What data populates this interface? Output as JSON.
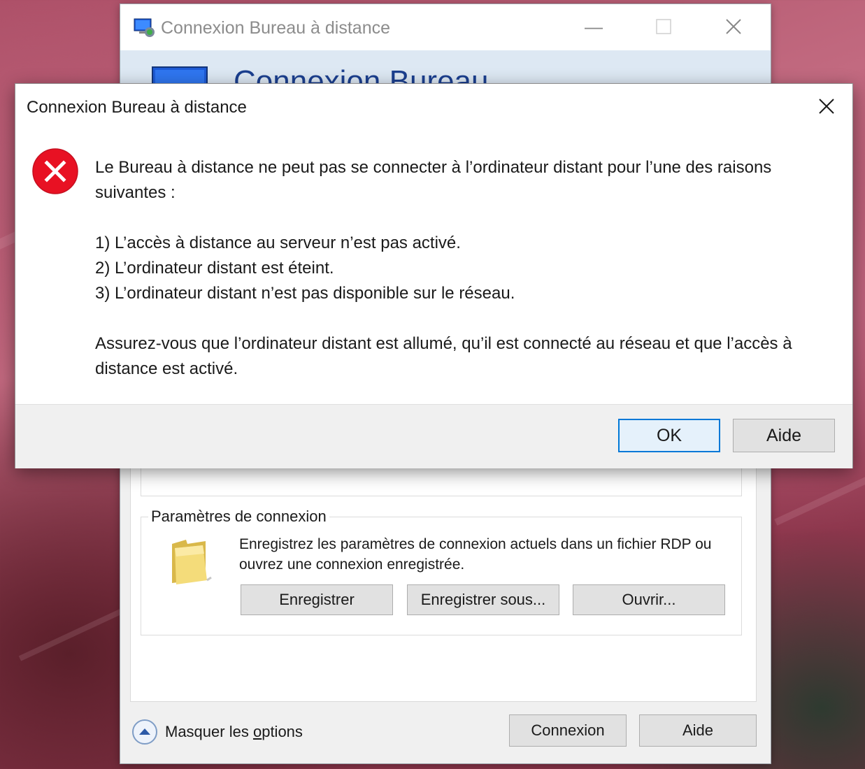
{
  "rdp_window": {
    "title": "Connexion Bureau à distance",
    "banner_title": "Connexion Bureau",
    "connection_settings": {
      "legend": "Paramètres de connexion",
      "description": "Enregistrez les paramètres de connexion actuels dans un fichier RDP ou ouvrez une connexion enregistrée.",
      "buttons": [
        "Enregistrer",
        "Enregistrer sous...",
        "Ouvrir..."
      ]
    },
    "footer": {
      "toggle_label_prefix": "Masquer les ",
      "toggle_label_accel": "o",
      "toggle_label_suffix": "ptions",
      "connect_label": "Connexion",
      "help_label": "Aide"
    }
  },
  "error_dialog": {
    "title": "Connexion Bureau à distance",
    "message_intro": "Le Bureau à distance ne peut pas se connecter à l’ordinateur distant pour l’une des raisons suivantes :",
    "reasons": [
      "1) L’accès à distance au serveur n’est pas activé.",
      "2) L’ordinateur distant est éteint.",
      "3) L’ordinateur distant n’est pas disponible sur le réseau."
    ],
    "message_outro": "Assurez-vous que l’ordinateur distant est allumé, qu’il est connecté au réseau et que l’accès à distance est activé.",
    "ok_label": "OK",
    "help_label": "Aide"
  },
  "icons": {
    "error": "error-x-icon",
    "close": "close-icon",
    "folder": "folder-icon",
    "toggle": "chevron-up-icon",
    "app": "remote-desktop-icon"
  },
  "colors": {
    "error_red": "#e81123",
    "accent_blue": "#0078d7",
    "banner_title_blue": "#1b3f8f"
  }
}
